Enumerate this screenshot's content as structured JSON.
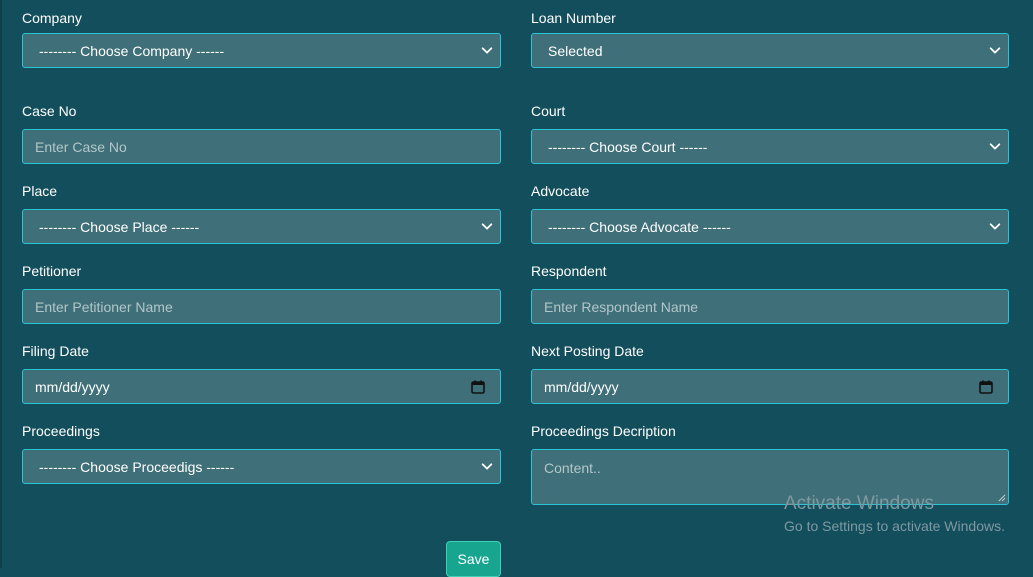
{
  "form": {
    "company": {
      "label": "Company",
      "value": "-------- Choose Company ------"
    },
    "loan_number": {
      "label": "Loan Number",
      "value": "Selected"
    },
    "case_no": {
      "label": "Case No",
      "placeholder": "Enter Case No"
    },
    "court": {
      "label": "Court",
      "value": "-------- Choose Court ------"
    },
    "place": {
      "label": "Place",
      "value": "-------- Choose Place ------"
    },
    "advocate": {
      "label": "Advocate",
      "value": "-------- Choose Advocate ------"
    },
    "petitioner": {
      "label": "Petitioner",
      "placeholder": "Enter Petitioner Name"
    },
    "respondent": {
      "label": "Respondent",
      "placeholder": "Enter Respondent Name"
    },
    "filing_date": {
      "label": "Filing Date",
      "value": "mm/dd/yyyy"
    },
    "next_posting_date": {
      "label": "Next Posting Date",
      "value": "mm/dd/yyyy"
    },
    "proceedings": {
      "label": "Proceedings",
      "value": "-------- Choose Proceedigs ------"
    },
    "proceedings_description": {
      "label": "Proceedings Decription",
      "placeholder": "Content.."
    },
    "save_label": "Save"
  },
  "watermark": {
    "title": "Activate Windows",
    "subtitle": "Go to Settings to activate Windows."
  },
  "colors": {
    "background": "#134e5c",
    "field_bg": "#3f6f78",
    "field_border": "#2cc3d6",
    "button": "#17a58f"
  }
}
